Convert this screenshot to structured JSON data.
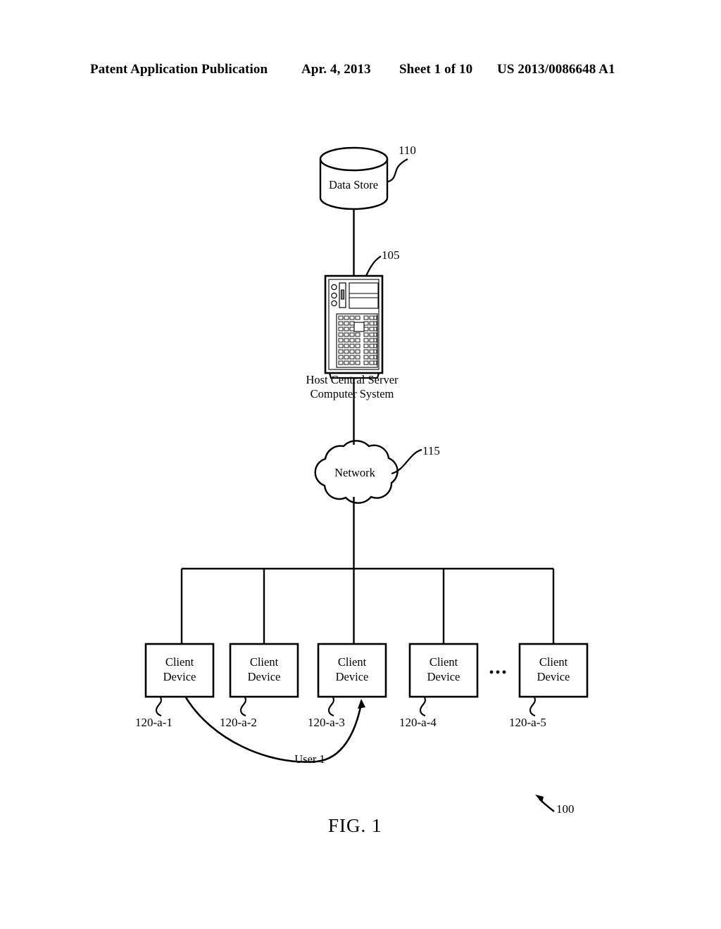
{
  "header": {
    "publication": "Patent Application Publication",
    "date": "Apr. 4, 2013",
    "sheet": "Sheet 1 of 10",
    "patent_number": "US 2013/0086648 A1"
  },
  "figure": {
    "caption": "FIG.  1",
    "system_ref": "100",
    "nodes": {
      "data_store": {
        "label": "Data Store",
        "ref": "110"
      },
      "server": {
        "label_line1": "Host Central Server",
        "label_line2": "Computer System",
        "ref": "105"
      },
      "network": {
        "label": "Network",
        "ref": "115"
      }
    },
    "clients": [
      {
        "line1": "Client",
        "line2": "Device",
        "ref": "120-a-1"
      },
      {
        "line1": "Client",
        "line2": "Device",
        "ref": "120-a-2"
      },
      {
        "line1": "Client",
        "line2": "Device",
        "ref": "120-a-3"
      },
      {
        "line1": "Client",
        "line2": "Device",
        "ref": "120-a-4"
      },
      {
        "line1": "Client",
        "line2": "Device",
        "ref": "120-a-5"
      }
    ],
    "ellipsis": "•••",
    "user_flow": {
      "label": "User 1"
    }
  },
  "colors": {
    "ink": "#000000",
    "paper": "#ffffff"
  }
}
